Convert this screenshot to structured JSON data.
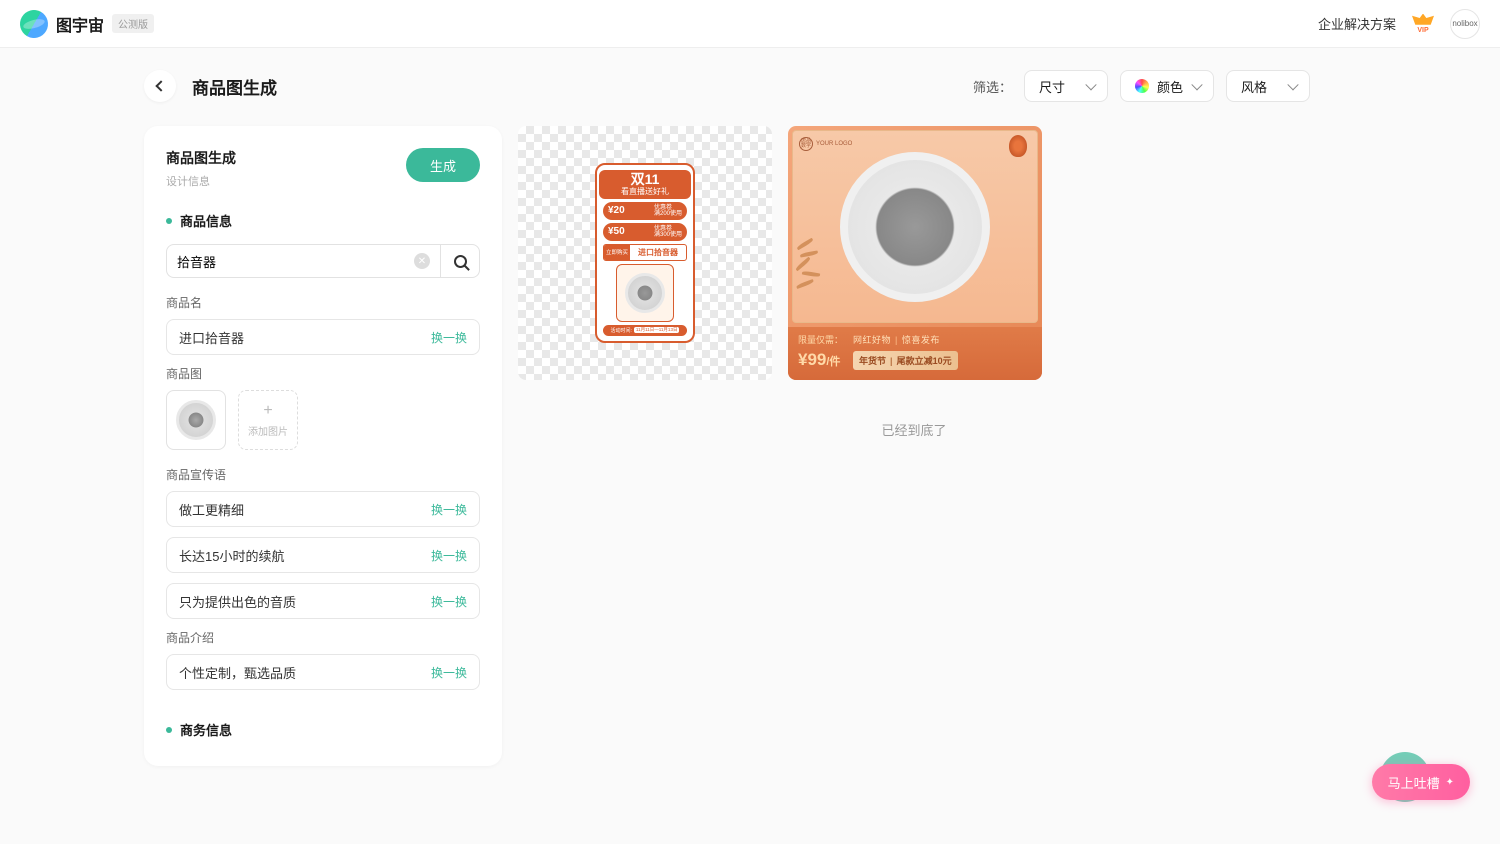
{
  "header": {
    "brand": "图宇宙",
    "beta_badge": "公测版",
    "enterprise_link": "企业解决方案",
    "vip_text": "VIP",
    "avatar_text": "nolibox"
  },
  "toolbar": {
    "page_title": "商品图生成",
    "filter_label": "筛选：",
    "dropdowns": {
      "size": "尺寸",
      "color": "颜色",
      "style": "风格"
    }
  },
  "panel": {
    "title": "商品图生成",
    "subtitle": "设计信息",
    "generate_button": "生成",
    "sections": {
      "product_info_title": "商品信息",
      "search_value": "拾音器",
      "product_name_label": "商品名",
      "product_name_value": "进口拾音器",
      "product_image_label": "商品图",
      "add_image_label": "添加图片",
      "slogan_label": "商品宣传语",
      "slogans": [
        "做工更精细",
        "长达15小时的续航",
        "只为提供出色的音质"
      ],
      "intro_label": "商品介绍",
      "intro_value": "个性定制，甄选品质",
      "business_info_title": "商务信息",
      "swap_label": "换一换"
    }
  },
  "cards": {
    "card1": {
      "title_main": "双11",
      "title_sub": "看直播送好礼",
      "coupon1_amount": "¥20",
      "coupon1_tag_top": "优惠卷",
      "coupon1_tag_bottom": "满200使用",
      "coupon2_amount": "¥50",
      "coupon2_tag_top": "优惠卷",
      "coupon2_tag_bottom": "满300使用",
      "prod_tag": "立即购买",
      "prod_name": "进口拾音器",
      "footer_label": "活动时间:",
      "footer_date": "11月11日—11月13日"
    },
    "card2": {
      "logo_icon": "唐品数字",
      "logo_text": "YOUR LOGO",
      "limited": "限量仅需：",
      "price": "¥99",
      "price_unit": "/件",
      "tag_left": "网红好物",
      "tag_right": "惊喜发布",
      "discount_left": "年货节",
      "discount_right": "尾款立减10元"
    }
  },
  "end_text": "已经到底了",
  "feedback_label": "马上吐槽"
}
